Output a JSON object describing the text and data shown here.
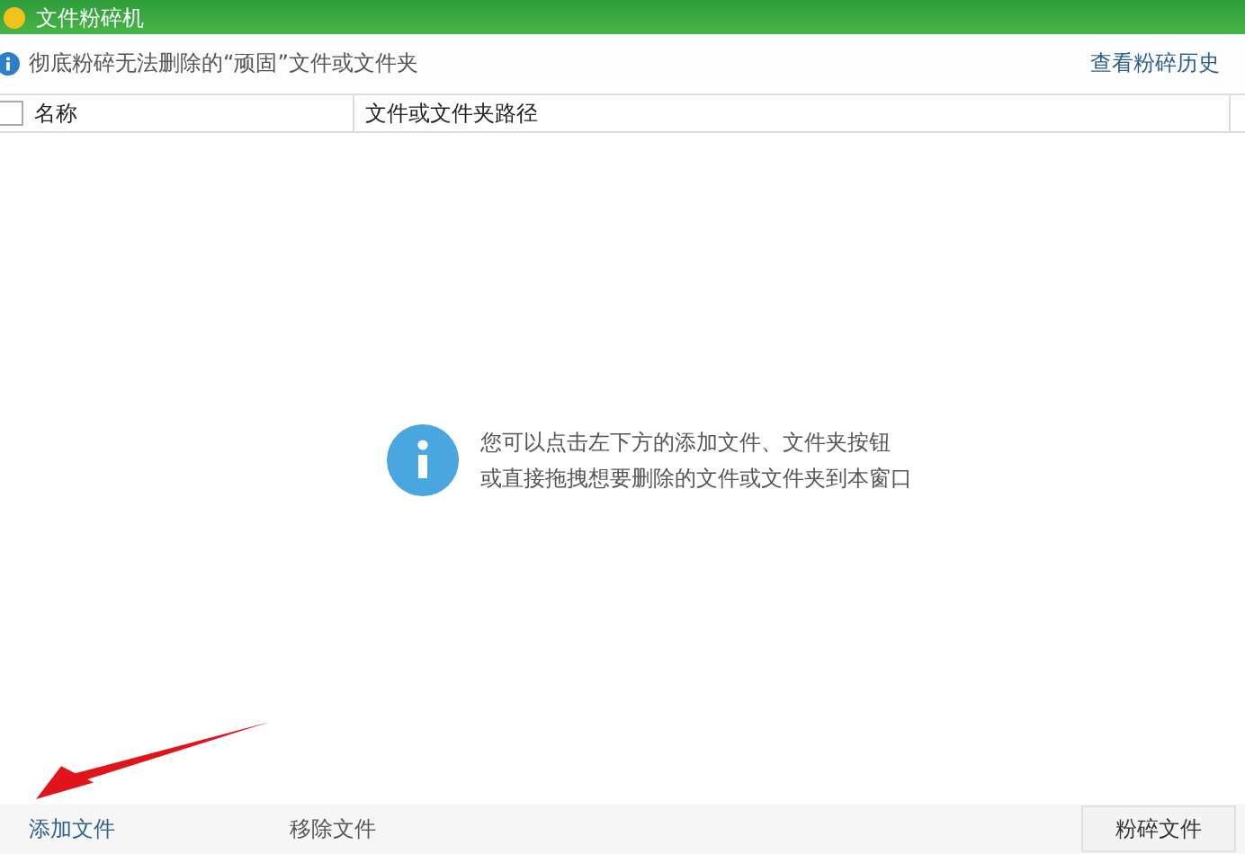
{
  "window": {
    "title": "文件粉碎机"
  },
  "info_bar": {
    "text": "彻底粉碎无法删除的“顽固”文件或文件夹",
    "link": "查看粉碎历史"
  },
  "table": {
    "select_all": {
      "checked": false
    },
    "columns": [
      "名称",
      "文件或文件夹路径"
    ]
  },
  "empty_hint": {
    "lines": [
      "您可以点击左下方的添加文件、文件夹按钮",
      "或直接拖拽想要删除的文件或文件夹到本窗口"
    ]
  },
  "bottom_bar": {
    "actions": [
      {
        "label": "添加文件",
        "kind": "link"
      },
      {
        "label": "移除文件",
        "kind": "link"
      },
      {
        "label": "粉碎文件",
        "kind": "button"
      }
    ]
  }
}
